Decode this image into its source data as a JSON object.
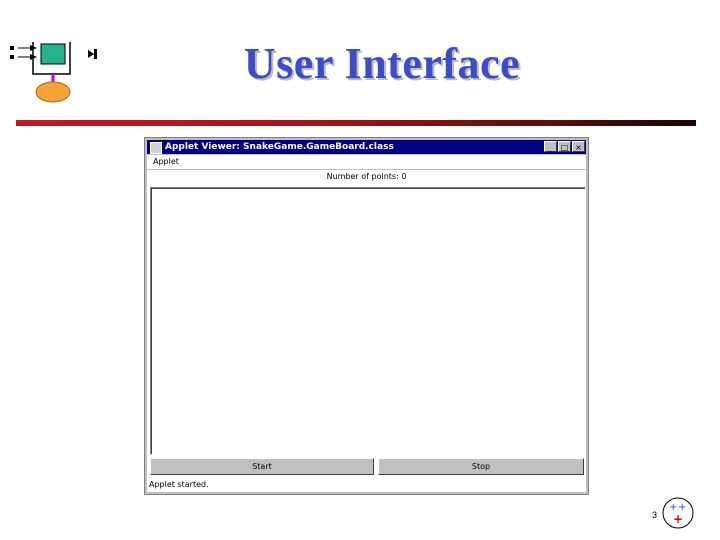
{
  "slide": {
    "title": "User Interface",
    "page_number": "3"
  },
  "window": {
    "title": "Applet Viewer: SnakeGame.GameBoard.class",
    "controls": {
      "minimize": "_",
      "maximize": "□",
      "close": "×"
    },
    "menu": [
      "Applet"
    ],
    "points_label": "Number of points: 0",
    "buttons": {
      "start": "Start",
      "stop": "Stop"
    },
    "status": "Applet started."
  },
  "colors": {
    "title_text": "#3b4bc9",
    "rule_start": "#c41a1a",
    "rule_end": "#1a0202",
    "window_titlebar": "#000080",
    "window_face": "#c0c0c0"
  },
  "icons": [
    "slide-logo-icon",
    "window-app-icon",
    "corner-logo-icon"
  ]
}
